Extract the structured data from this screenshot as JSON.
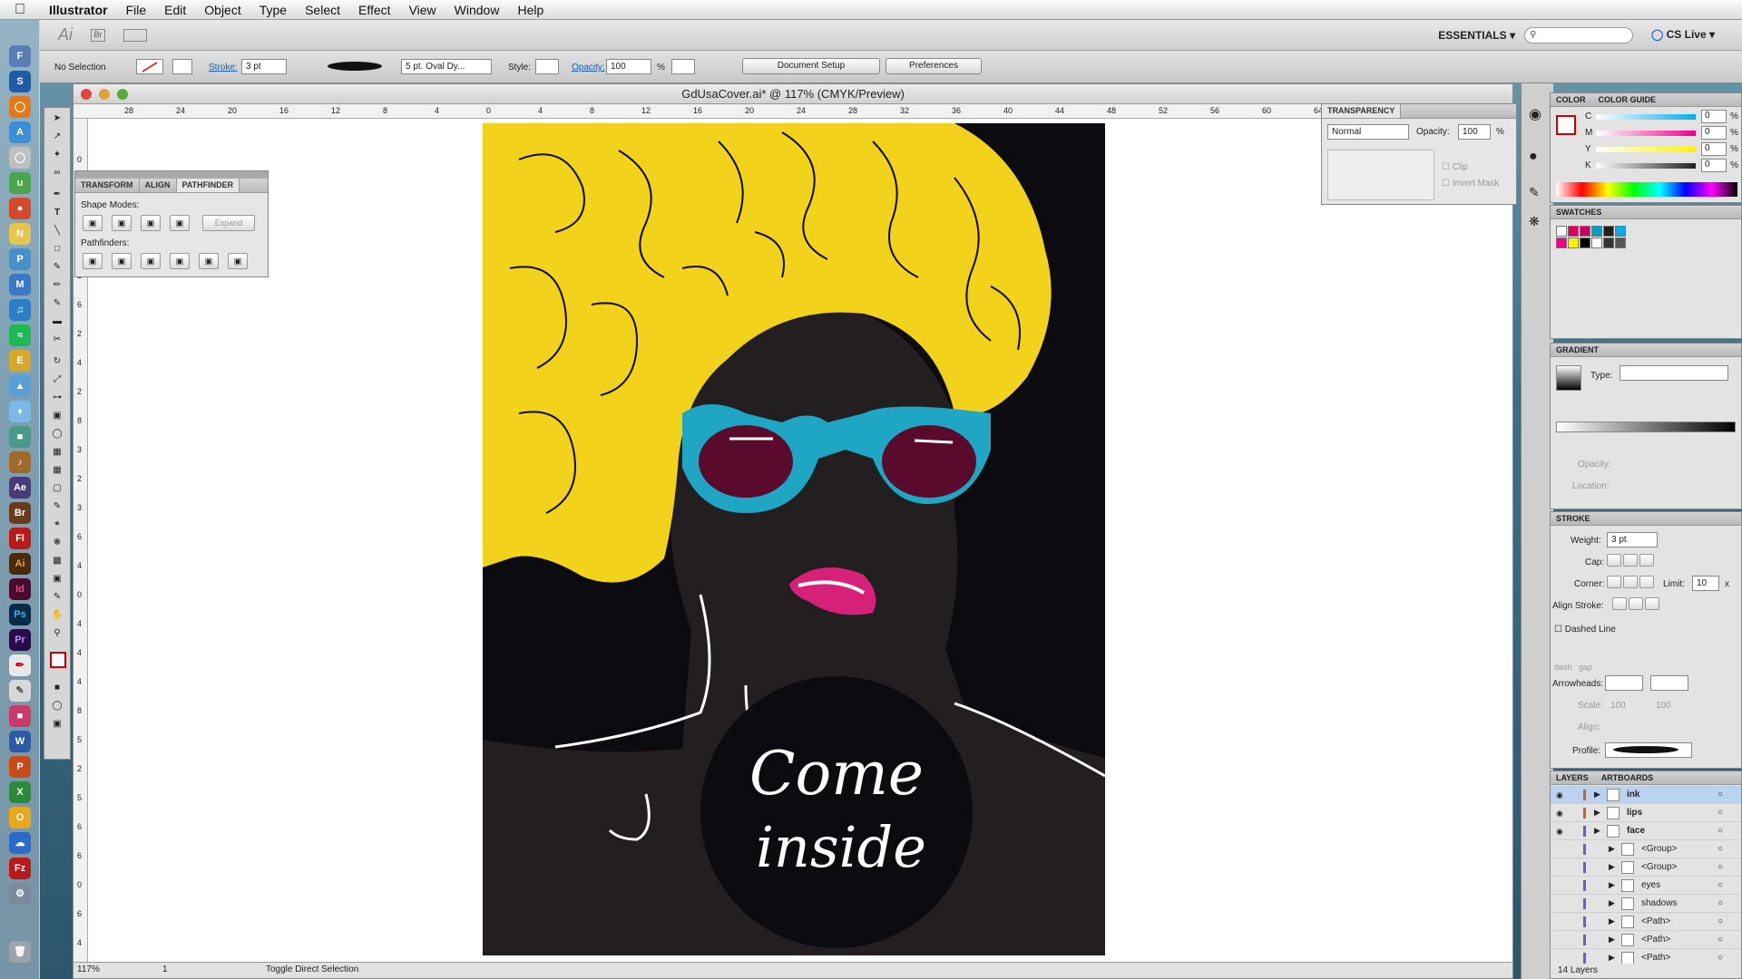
{
  "menubar": {
    "app": "Illustrator",
    "items": [
      "File",
      "Edit",
      "Object",
      "Type",
      "Select",
      "Effect",
      "View",
      "Window",
      "Help"
    ]
  },
  "appbar": {
    "ai_logo": "Ai",
    "br_logo": "Br",
    "workspace": "ESSENTIALS",
    "cs_live": "CS Live"
  },
  "control": {
    "selection": "No Selection",
    "stroke_label": "Stroke:",
    "stroke_value": "3 pt",
    "brush": "5 pt. Oval Dy...",
    "style_label": "Style:",
    "opacity_label": "Opacity:",
    "opacity_value": "100",
    "percent": "%",
    "doc_setup": "Document Setup",
    "preferences": "Preferences"
  },
  "document": {
    "title": "GdUsaCover.ai* @ 117% (CMYK/Preview)",
    "zoom": "117%",
    "page": "1",
    "status": "Toggle Direct Selection",
    "ruler_h": [
      "28",
      "24",
      "20",
      "16",
      "12",
      "8",
      "4",
      "0",
      "4",
      "8",
      "12",
      "16",
      "20",
      "24",
      "28",
      "32",
      "36",
      "40",
      "44",
      "48",
      "52",
      "56",
      "60",
      "64"
    ],
    "ruler_v": [
      "0",
      "4",
      "8",
      "2",
      "1",
      "6",
      "2",
      "4",
      "2",
      "8",
      "3",
      "2",
      "3",
      "6",
      "4",
      "0",
      "4",
      "4",
      "4",
      "8",
      "5",
      "2",
      "5",
      "6",
      "6",
      "0",
      "6",
      "4"
    ]
  },
  "pathfinder": {
    "tabs": [
      "TRANSFORM",
      "ALIGN",
      "PATHFINDER"
    ],
    "shape_modes": "Shape Modes:",
    "expand": "Expand",
    "pathfinders": "Pathfinders:"
  },
  "artwork": {
    "text_line1": "Come",
    "text_line2": "inside",
    "hair_color": "#f2d21a",
    "glasses_color": "#1ea6c4",
    "lips_color": "#d6207a",
    "bg_color": "#0b0b10",
    "skin_color": "#231f20"
  },
  "transparency": {
    "title": "TRANSPARENCY",
    "mode": "Normal",
    "opacity_label": "Opacity:",
    "opacity_value": "100",
    "percent": "%",
    "clip": "Clip",
    "invert_mask": "Invert Mask"
  },
  "color": {
    "tabs": [
      "COLOR",
      "COLOR GUIDE"
    ],
    "channels": [
      {
        "label": "C",
        "value": "0",
        "color": "#00aeef"
      },
      {
        "label": "M",
        "value": "0",
        "color": "#ec008c"
      },
      {
        "label": "Y",
        "value": "0",
        "color": "#fff200"
      },
      {
        "label": "K",
        "value": "0",
        "color": "#231f20"
      }
    ],
    "percent": "%"
  },
  "swatches": {
    "title": "SWATCHES",
    "colors": [
      "#ffffff",
      "#e0005a",
      "#cc0066",
      "#00a0c6",
      "#231f20",
      "#00aeef",
      "#ec008c",
      "#fff200",
      "#000000",
      "#ffffff",
      "#333333",
      "#555555"
    ]
  },
  "gradient": {
    "title": "GRADIENT",
    "type_label": "Type:",
    "opacity_label": "Opacity:",
    "location_label": "Location:",
    "percent": "%"
  },
  "stroke": {
    "title": "STROKE",
    "weight_label": "Weight:",
    "weight_value": "3 pt",
    "cap_label": "Cap:",
    "corner_label": "Corner:",
    "limit_label": "Limit:",
    "limit_value": "10",
    "x": "x",
    "align_label": "Align Stroke:",
    "dashed_label": "Dashed Line",
    "dash": "dash",
    "gap": "gap",
    "arrowheads_label": "Arrowheads:",
    "scale_label": "Scale:",
    "scale1": "100",
    "scale2": "100",
    "align2_label": "Align:",
    "profile_label": "Profile:"
  },
  "layers": {
    "tabs": [
      "LAYERS",
      "ARTBOARDS"
    ],
    "rows": [
      {
        "name": "ink",
        "indent": 0,
        "color": "#c86428",
        "selected": true,
        "eye": true
      },
      {
        "name": "lips",
        "indent": 0,
        "color": "#c86428",
        "selected": false,
        "eye": true
      },
      {
        "name": "face",
        "indent": 0,
        "color": "#6a5acd",
        "selected": false,
        "eye": true
      },
      {
        "name": "<Group>",
        "indent": 1,
        "color": "#6a5acd",
        "selected": false,
        "eye": false
      },
      {
        "name": "<Group>",
        "indent": 1,
        "color": "#6a5acd",
        "selected": false,
        "eye": false
      },
      {
        "name": "eyes",
        "indent": 1,
        "color": "#6a5acd",
        "selected": false,
        "eye": false
      },
      {
        "name": "shadows",
        "indent": 1,
        "color": "#6a5acd",
        "selected": false,
        "eye": false
      },
      {
        "name": "<Path>",
        "indent": 1,
        "color": "#6a5acd",
        "selected": false,
        "eye": false
      },
      {
        "name": "<Path>",
        "indent": 1,
        "color": "#6a5acd",
        "selected": false,
        "eye": false
      },
      {
        "name": "<Path>",
        "indent": 1,
        "color": "#6a5acd",
        "selected": false,
        "eye": false
      }
    ],
    "count": "14 Layers"
  }
}
